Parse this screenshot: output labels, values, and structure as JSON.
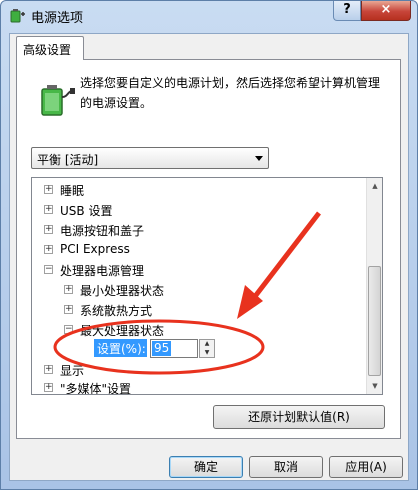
{
  "window": {
    "title": "电源选项",
    "help_label": "?",
    "close_label": "×"
  },
  "tab": {
    "label": "高级设置"
  },
  "description": "选择您要自定义的电源计划，然后选择您希望计算机管理的电源设置。",
  "plan_select": {
    "value": "平衡 [活动]"
  },
  "tree": {
    "items": [
      {
        "label": "睡眠",
        "expander": "+"
      },
      {
        "label": "USB 设置",
        "expander": "+"
      },
      {
        "label": "电源按钮和盖子",
        "expander": "+"
      },
      {
        "label": "PCI Express",
        "expander": "+"
      },
      {
        "label": "处理器电源管理",
        "expander": "−"
      },
      {
        "label": "最小处理器状态",
        "expander": "+"
      },
      {
        "label": "系统散热方式",
        "expander": "+"
      },
      {
        "label": "最大处理器状态",
        "expander": "−"
      },
      {
        "label": "显示",
        "expander": "+"
      },
      {
        "label": "\"多媒体\"设置",
        "expander": "+"
      }
    ],
    "setting_label": "设置(%):",
    "setting_value": "95"
  },
  "buttons": {
    "restore": "还原计划默认值(R)",
    "ok": "确定",
    "cancel": "取消",
    "apply": "应用(A)"
  },
  "colors": {
    "selection": "#3399ff",
    "annotation": "#e8321e"
  },
  "icons": {
    "title": "battery-plug-icon",
    "description": "battery-plug-icon",
    "combo": "chevron-down-icon",
    "spinner": "spin-arrows-icon"
  }
}
